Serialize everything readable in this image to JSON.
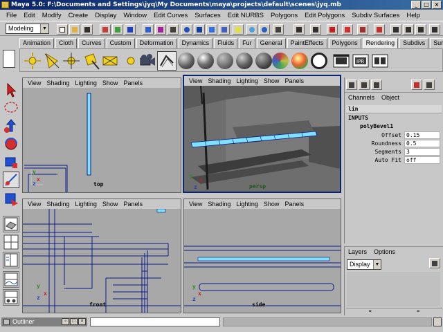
{
  "window": {
    "title": "Maya 5.0: F:\\Documents and Settings\\jyq\\My Documents\\maya\\projects\\default\\scenes\\jyq.mb",
    "minimize_glyph": "_",
    "maximize_glyph": "□",
    "close_glyph": "×"
  },
  "menubar": {
    "items": [
      "File",
      "Edit",
      "Modify",
      "Create",
      "Display",
      "Window",
      "Edit Curves",
      "Surfaces",
      "Edit NURBS",
      "Polygons",
      "Edit Polygons",
      "Subdiv Surfaces",
      "Help"
    ]
  },
  "statusline": {
    "mode": "Modeling",
    "dropdown_arrow": "▼"
  },
  "shelf": {
    "tabs": [
      "Animation",
      "Cloth",
      "Curves",
      "Custom",
      "Deformation",
      "Dynamics",
      "Fluids",
      "Fur",
      "General",
      "PaintEffects",
      "Polygons",
      "Rendering",
      "Subdivs",
      "Surfaces"
    ],
    "active_tab": "Rendering",
    "icons": [
      "point-light-icon",
      "spot-light-icon",
      "directional-light-icon",
      "area-light-icon",
      "ambient-light-icon",
      "volume-light-icon",
      "camera-icon",
      "render-globals-icon",
      "blinn-sphere-icon",
      "phong-sphere-icon",
      "lambert-sphere-icon",
      "anisotropic-sphere-icon",
      "layered-sphere-icon",
      "ramp-sphere-icon",
      "shading-group-icon",
      "render-icon",
      "ipr-render-icon",
      "batch-render-icon"
    ]
  },
  "viewports": [
    {
      "id": "top",
      "menu": [
        "View",
        "Shading",
        "Lighting",
        "Show",
        "Panels"
      ],
      "label": "top",
      "active": false
    },
    {
      "id": "persp",
      "menu": [
        "View",
        "Shading",
        "Lighting",
        "Show",
        "Panels"
      ],
      "label": "persp",
      "active": true
    },
    {
      "id": "front",
      "menu": [
        "View",
        "Shading",
        "Lighting",
        "Show",
        "Panels"
      ],
      "label": "front",
      "active": false
    },
    {
      "id": "side",
      "menu": [
        "View",
        "Shading",
        "Lighting",
        "Show",
        "Panels"
      ],
      "label": "side",
      "active": false
    }
  ],
  "axes": {
    "x": "x",
    "y": "y",
    "z": "z"
  },
  "channel_box": {
    "menu": [
      "Channels",
      "Object"
    ],
    "object": "lin",
    "inputs_header": "INPUTS",
    "node": "polyBevel1",
    "attributes": [
      {
        "name": "Offset",
        "value": "0.15"
      },
      {
        "name": "Roundness",
        "value": "0.5"
      },
      {
        "name": "Segments",
        "value": "3"
      },
      {
        "name": "Auto Fit",
        "value": "off"
      }
    ]
  },
  "layers": {
    "menu": [
      "Layers",
      "Options"
    ],
    "type": "Display",
    "dropdown_arrow": "▼",
    "scroll_left": "«",
    "scroll_right": "»"
  },
  "bottom": {
    "outliner_title": "Outliner",
    "outliner_buttons": [
      "▫",
      "□",
      "×"
    ],
    "command_text": "",
    "help_text": ""
  },
  "colors": {
    "title_bg": "#0a246a",
    "viewport_bg": "#a8a8a8",
    "persp_bg": "#6e6e6e",
    "active_border": "#0c2470",
    "wire_blue": "#0a1a8a",
    "highlight_cyan": "#7fe0ff"
  }
}
